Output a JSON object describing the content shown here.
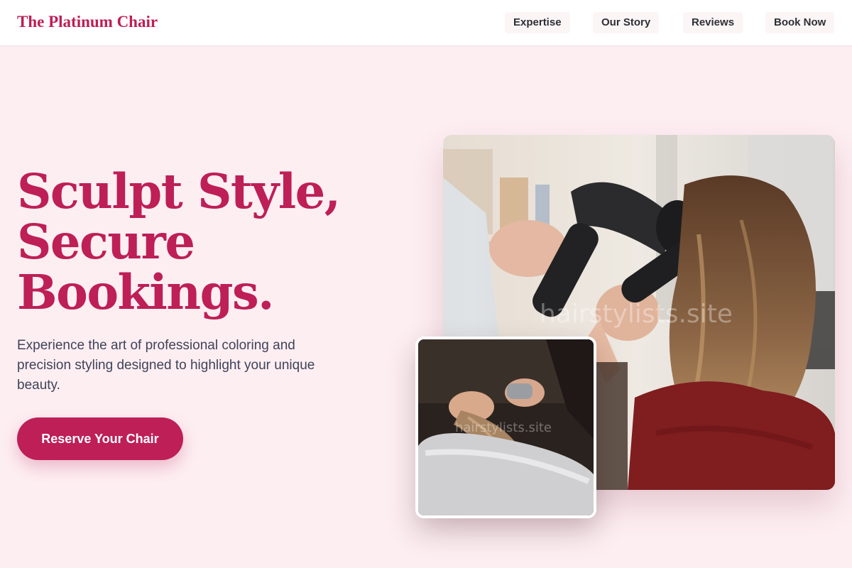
{
  "nav": {
    "brand": "The Platinum Chair",
    "links": [
      "Expertise",
      "Our Story",
      "Reviews",
      "Book Now"
    ]
  },
  "hero": {
    "headline": [
      "Sculpt Style,",
      "Secure",
      "Bookings."
    ],
    "subtitle": "Experience the art of professional coloring and precision styling designed to highlight your unique beauty.",
    "cta": "Reserve Your Chair"
  },
  "images": {
    "watermark": "hairstylists.site"
  },
  "colors": {
    "brand": "#bd1f56",
    "background": "#fdeef2",
    "text": "#3f4358"
  }
}
